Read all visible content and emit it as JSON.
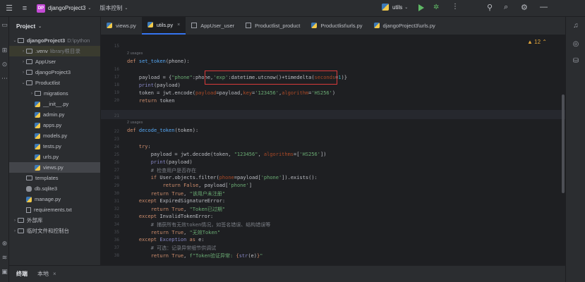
{
  "titlebar": {
    "project_badge": "DP",
    "project_name": "djangoProject3",
    "vcs_label": "版本控制",
    "run_config": "utils"
  },
  "project_panel": {
    "title": "Project",
    "items": [
      {
        "label": "djangoProject3",
        "hint": "D:\\python",
        "level": 0,
        "type": "folder",
        "open": true
      },
      {
        "label": ".venv",
        "hint": "library根目录",
        "level": 1,
        "type": "folder",
        "open": false
      },
      {
        "label": "AppUser",
        "level": 1,
        "type": "folder",
        "open": false
      },
      {
        "label": "djangoProject3",
        "level": 1,
        "type": "folder",
        "open": false
      },
      {
        "label": "Productlist",
        "level": 1,
        "type": "folder",
        "open": true
      },
      {
        "label": "migrations",
        "level": 2,
        "type": "folder",
        "open": false
      },
      {
        "label": "__init__.py",
        "level": 2,
        "type": "py"
      },
      {
        "label": "admin.py",
        "level": 2,
        "type": "py"
      },
      {
        "label": "apps.py",
        "level": 2,
        "type": "py"
      },
      {
        "label": "models.py",
        "level": 2,
        "type": "py"
      },
      {
        "label": "tests.py",
        "level": 2,
        "type": "py"
      },
      {
        "label": "urls.py",
        "level": 2,
        "type": "py"
      },
      {
        "label": "views.py",
        "level": 2,
        "type": "py",
        "selected": true
      },
      {
        "label": "templates",
        "level": 1,
        "type": "folder"
      },
      {
        "label": "db.sqlite3",
        "level": 1,
        "type": "db"
      },
      {
        "label": "manage.py",
        "level": 1,
        "type": "py"
      },
      {
        "label": "requirements.txt",
        "level": 1,
        "type": "file"
      },
      {
        "label": "外部库",
        "level": 0,
        "type": "folder",
        "open": false
      },
      {
        "label": "临时文件和控制台",
        "level": 0,
        "type": "folder",
        "open": false
      }
    ]
  },
  "tabs": [
    {
      "label": "views.py",
      "icon": "python-icon"
    },
    {
      "label": "utils.py",
      "icon": "python-icon",
      "active": true,
      "close": "×"
    },
    {
      "label": "AppUser_user",
      "icon": "table-icon"
    },
    {
      "label": "Productlist_product",
      "icon": "table-icon"
    },
    {
      "label": "Productlist\\urls.py",
      "icon": "python-icon"
    },
    {
      "label": "djangoProject3\\urls.py",
      "icon": "python-icon"
    }
  ],
  "editor": {
    "warning_count": "12",
    "line_numbers": [
      "15",
      "",
      "16",
      "17",
      "18",
      "19",
      "20",
      "",
      "21",
      "",
      "22",
      "23",
      "24",
      "25",
      "26",
      "27",
      "28",
      "29",
      "30",
      "31",
      "32",
      "33",
      "34",
      "35",
      "36",
      "37",
      "38"
    ],
    "usages_1": "2 usages",
    "usages_2": "2 usages"
  },
  "bottom": {
    "terminal_label": "终端",
    "local_tab": "本地",
    "local_close": "×"
  },
  "colors": {
    "accent": "#3574f0",
    "highlight_box": "#d93a3a",
    "keyword": "#cf8e6d",
    "function": "#56a8f5",
    "string": "#6aab73"
  }
}
